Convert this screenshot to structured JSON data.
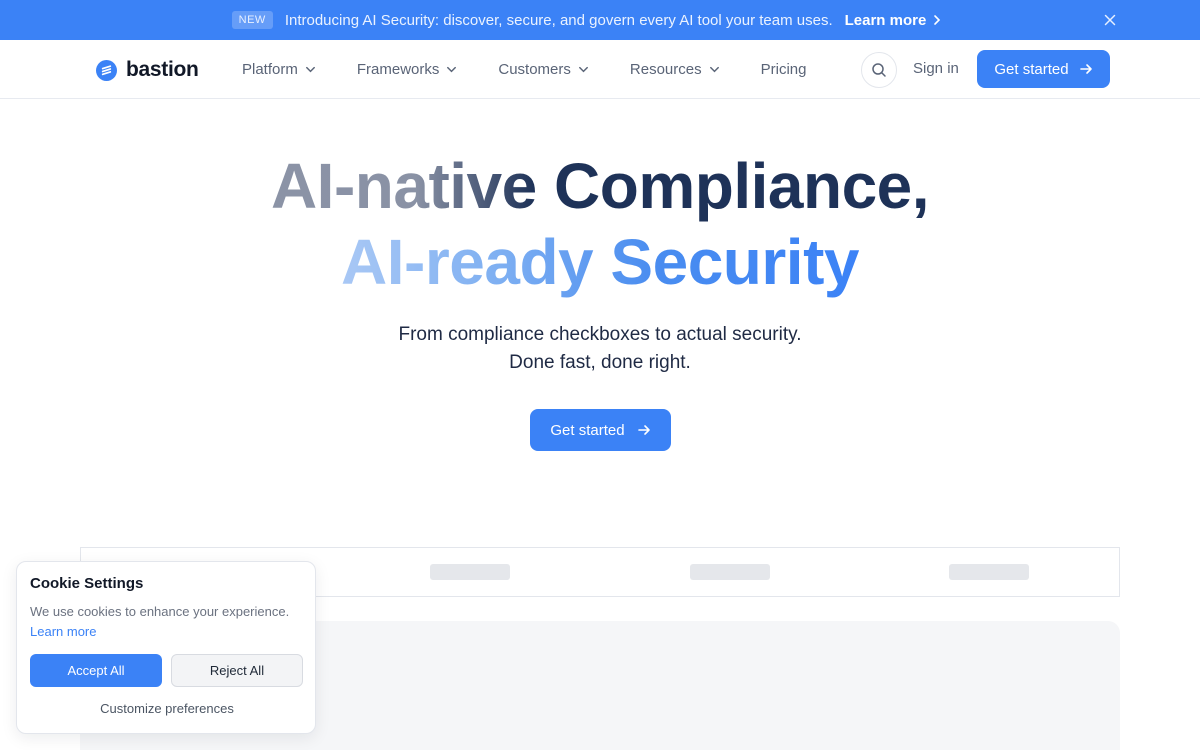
{
  "announcement": {
    "badge": "NEW",
    "text": "Introducing AI Security: discover, secure, and govern every AI tool your team uses.",
    "link": "Learn more"
  },
  "nav": {
    "logo": "bastion",
    "items": [
      {
        "label": "Platform",
        "has_dropdown": true
      },
      {
        "label": "Frameworks",
        "has_dropdown": true
      },
      {
        "label": "Customers",
        "has_dropdown": true
      },
      {
        "label": "Resources",
        "has_dropdown": true
      },
      {
        "label": "Pricing",
        "has_dropdown": false
      }
    ],
    "signin": "Sign in",
    "cta": "Get started"
  },
  "hero": {
    "line1": "AI-native Compliance,",
    "line2": "AI-ready Security",
    "sub1": "From compliance checkboxes to actual security.",
    "sub2": "Done fast, done right.",
    "cta": "Get started"
  },
  "cookie": {
    "title": "Cookie Settings",
    "desc": "We use cookies to enhance your experience.",
    "link": "Learn more",
    "accept": "Accept All",
    "reject": "Reject All",
    "customize": "Customize preferences"
  },
  "colors": {
    "accent": "#3b82f6",
    "heading": "#1e3258"
  }
}
